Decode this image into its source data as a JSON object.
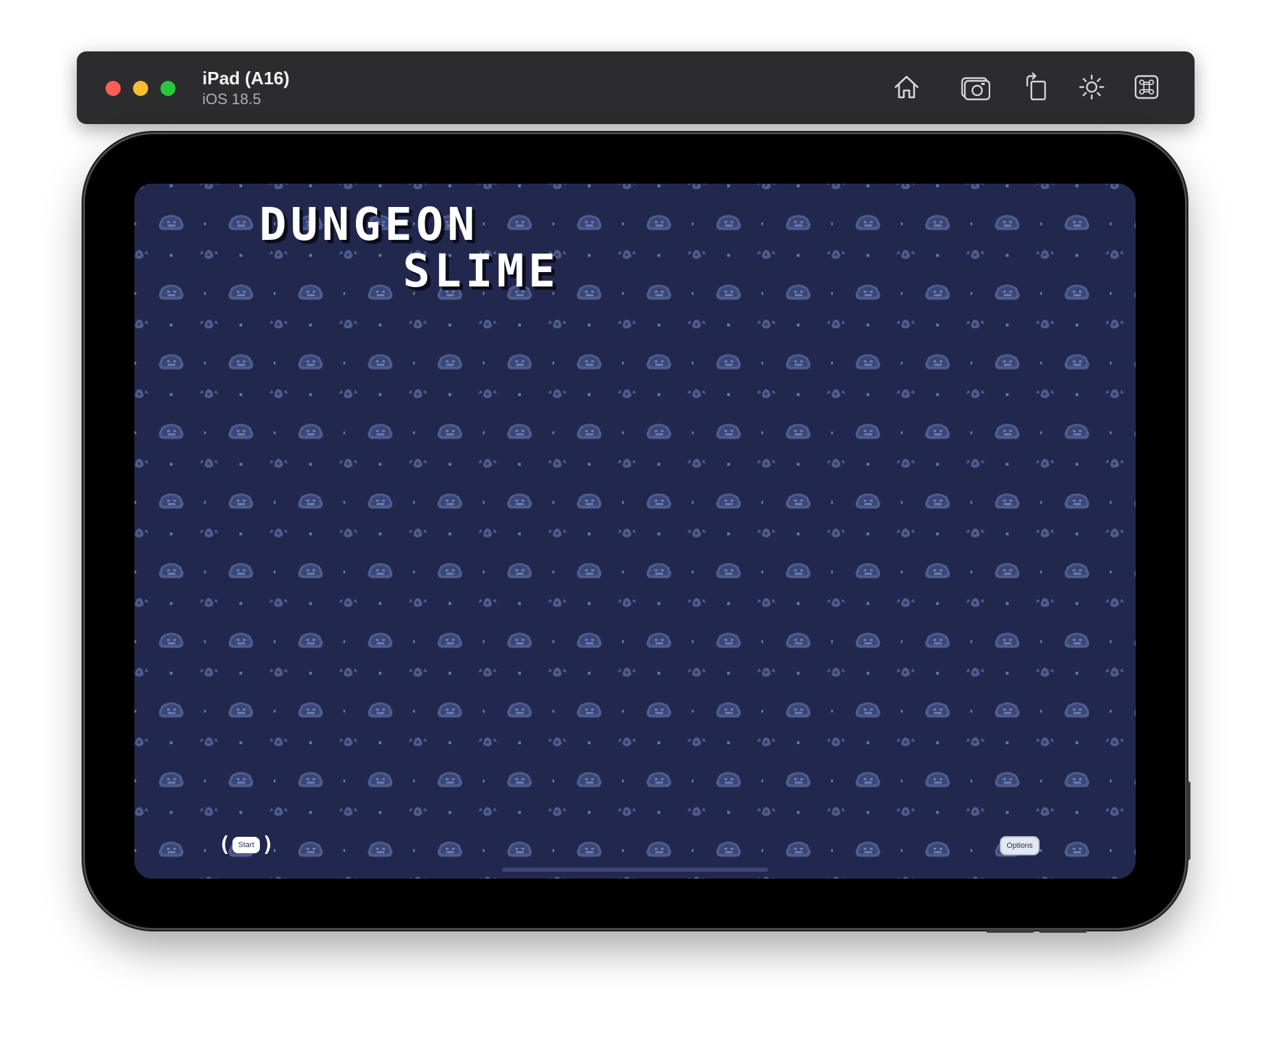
{
  "window": {
    "device_name": "iPad (A16)",
    "os_version": "iOS 18.5",
    "toolbar_icons": [
      "home-icon",
      "screenshot-icon",
      "rotate-icon",
      "brightness-icon",
      "command-icon"
    ]
  },
  "game": {
    "title_line1": "DUNGEON",
    "title_line2": "SLIME",
    "start_label": "Start",
    "start_bracket_left": "(",
    "start_bracket_right": ")",
    "options_label": "Options",
    "background_color": "#22284d",
    "pattern_color": "#5a6a9a"
  }
}
